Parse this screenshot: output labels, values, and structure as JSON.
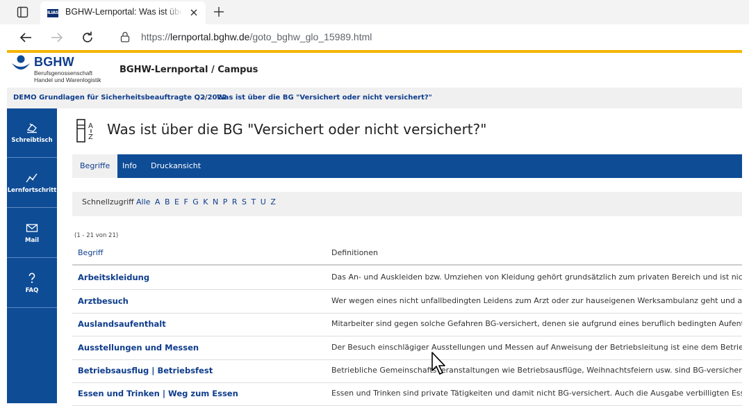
{
  "browser": {
    "tab_title": "BGHW-Lernportal: Was ist über die BG \"Versichert oder nicht versichert?\"",
    "tab_favicon_text": "ILIAS",
    "url_prefix": "https://",
    "url_host": "lernportal.bghw.de",
    "url_path": "/goto_bghw_glo_15989.html"
  },
  "header": {
    "logo_text": "BGHW",
    "logo_sub1": "Berufsgenossenschaft",
    "logo_sub2": "Handel und Warenlogistik",
    "portal_title": "BGHW-Lernportal / Campus"
  },
  "breadcrumb": {
    "items": [
      "DEMO Grundlagen für Sicherheitsbeauftragte Q2/2022",
      "Was ist über die BG \"Versichert oder nicht versichert?\""
    ],
    "separator": "›"
  },
  "sidebar": {
    "items": [
      {
        "label": "Schreibtisch",
        "icon": "desk-icon"
      },
      {
        "label": "Lernfortschritt",
        "icon": "progress-chart-icon"
      },
      {
        "label": "Mail",
        "icon": "mail-icon"
      },
      {
        "label": "FAQ",
        "icon": "question-icon"
      }
    ]
  },
  "main": {
    "title": "Was ist über die BG \"Versichert oder nicht versichert?\"",
    "tabs": [
      {
        "label": "Begriffe",
        "active": true
      },
      {
        "label": "Info",
        "active": false
      },
      {
        "label": "Druckansicht",
        "active": false
      }
    ],
    "quick_access_label": "Schnellzugriff",
    "quick_access_links": [
      "Alle",
      "A",
      "B",
      "E",
      "F",
      "G",
      "K",
      "N",
      "P",
      "R",
      "S",
      "T",
      "U",
      "Z"
    ],
    "count": "(1 - 21 von 21)",
    "table": {
      "headers": [
        "Begriff",
        "Definitionen"
      ],
      "rows": [
        {
          "term": "Arbeitskleidung",
          "definition": "Das An- und Auskleiden bzw. Umziehen von Kleidung gehört grundsätzlich zum privaten Bereich und ist nicht"
        },
        {
          "term": "Arztbesuch",
          "definition": "Wer wegen eines nicht unfallbedingten Leidens zum Arzt oder zur hauseigenen Werksambulanz geht und auf"
        },
        {
          "term": "Auslandsaufenthalt",
          "definition": "Mitarbeiter sind gegen solche Gefahren BG-versichert, denen sie aufgrund eines beruflich bedingten Aufenth"
        },
        {
          "term": "Ausstellungen und Messen",
          "definition": "Der Besuch einschlägiger Ausstellungen und Messen auf Anweisung der Betriebsleitung ist eine dem Betrieb"
        },
        {
          "term": "Betriebsausflug | Betriebsfest",
          "definition": "Betriebliche Gemeinschaftsveranstaltungen wie Betriebsausflüge, Weihnachtsfeiern usw. sind BG-versichert."
        },
        {
          "term": "Essen und Trinken | Weg zum Essen",
          "definition": "Essen und Trinken sind private Tätigkeiten und damit nicht BG-versichert. Auch die Ausgabe verbilligten Esse"
        }
      ]
    }
  },
  "colors": {
    "brand_blue": "#0e4c96",
    "link_blue": "#0e3c8c",
    "accent_yellow": "#f5b400"
  }
}
